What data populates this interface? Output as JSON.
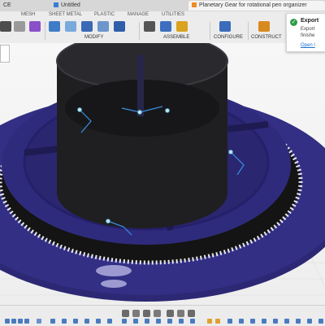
{
  "tabs": [
    {
      "label": "CE",
      "active": false
    },
    {
      "label": "Untitled",
      "active": false
    },
    {
      "label": "Planetary Gear for rotational pen organizer",
      "active": true
    }
  ],
  "menu": [
    "MESH",
    "SHEET METAL",
    "PLASTIC",
    "MANAGE",
    "UTILITIES"
  ],
  "toolbar_groups": [
    "MODIFY",
    "ASSEMBLE",
    "CONFIGURE",
    "CONSTRUCT"
  ],
  "notification": {
    "title": "Export",
    "body": "Export finishe",
    "link": "Open l"
  },
  "colors": {
    "model_blue": "#2e2a78",
    "ring_black": "#1a1a1a",
    "sketch_blue": "#3b8fe0",
    "success_green": "#2e9d47",
    "link_blue": "#1a6fd1"
  },
  "icons": [
    "save-icon",
    "undo-icon",
    "create-sketch-icon",
    "modify-icon",
    "joint-icon",
    "configure-icon",
    "construct-plane-icon",
    "orbit-icon",
    "pan-icon",
    "zoom-icon",
    "display-settings-icon",
    "grid-icon",
    "timeline-play-icon"
  ]
}
